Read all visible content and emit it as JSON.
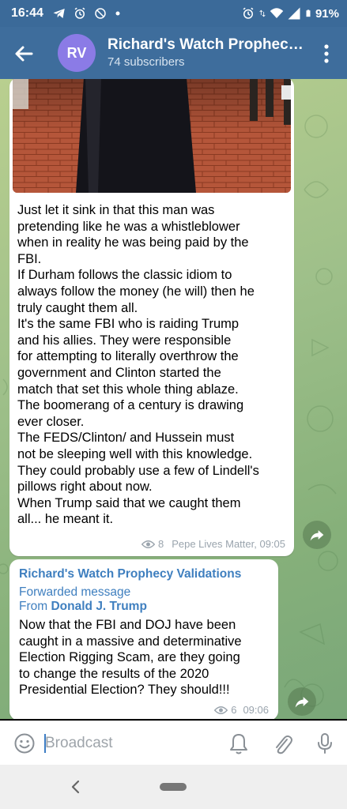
{
  "status_bar": {
    "time": "16:44",
    "battery": "91%",
    "left_icons": [
      "telegram-icon",
      "alarm-icon",
      "no-disturb-icon",
      "dot-icon"
    ],
    "right_icons": [
      "alarm-icon",
      "data-arrows-icon",
      "wifi-icon",
      "signal-icon",
      "battery-icon"
    ]
  },
  "header": {
    "avatar_initials": "RV",
    "avatar_color": "#8b7be6",
    "title": "Richard's Watch Prophecy Validations",
    "subtitle": "74 subscribers"
  },
  "messages": [
    {
      "lines": [
        "Just let it sink in that this man was",
        "pretending like he was a whistleblower",
        "when in reality he was being paid by the",
        "FBI.",
        "If Durham follows the classic idiom to",
        "always follow the money (he will) then he",
        "truly caught them all.",
        "It's the same FBI who is raiding Trump",
        "and his allies. They were responsible",
        "for attempting to literally overthrow the",
        "government and Clinton started the",
        "match that set this whole thing ablaze.",
        "The boomerang of a century is drawing",
        "ever closer.",
        "The FEDS/Clinton/ and Hussein must",
        "not be sleeping well with this knowledge.",
        "They could probably use a few of Lindell's",
        "pillows right about now.",
        "When Trump said that we caught them",
        "all... he meant it."
      ],
      "views": "8",
      "signature": "Pepe Lives Matter, 09:05"
    },
    {
      "channel_name": "Richard's Watch Prophecy Validations",
      "forwarded_label": "Forwarded message",
      "from_label": "From",
      "from_name": "Donald J. Trump",
      "lines": [
        "Now that the FBI and DOJ have been",
        "caught in a massive and determinative",
        "Election Rigging Scam, are they going",
        "to change the results of the 2020",
        "Presidential Election? They should!!!"
      ],
      "views": "6",
      "time": "09:06"
    }
  ],
  "input": {
    "placeholder": "Broadcast"
  },
  "colors": {
    "header_bg": "#3e6d9c",
    "link_blue": "#3f7fbf",
    "meta_gray": "#9aa4ad"
  }
}
